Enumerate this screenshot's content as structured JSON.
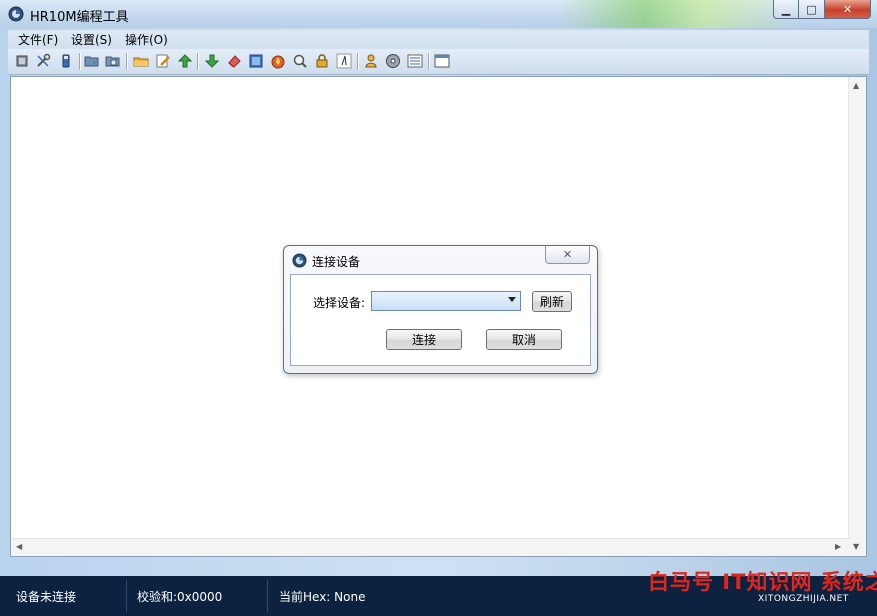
{
  "window": {
    "title": "HR10M编程工具",
    "controls": {
      "minimize": "▁",
      "maximize": "□",
      "close": "✕"
    }
  },
  "menu": {
    "items": [
      "文件(F)",
      "设置(S)",
      "操作(O)"
    ]
  },
  "toolbar": {
    "icons": [
      "chip-icon",
      "tools-icon",
      "usb-icon",
      "folder-open-icon",
      "save-icon",
      "open-file-icon",
      "edit-icon",
      "upload-arrow-icon",
      "download-arrow-icon",
      "eraser-icon",
      "blank-check-icon",
      "fire-icon",
      "search-icon",
      "lock-icon",
      "font-icon",
      "person-icon",
      "disc-icon",
      "list-icon",
      "window-icon"
    ]
  },
  "dialog": {
    "title": "连接设备",
    "close_glyph": "✕",
    "select_label": "选择设备:",
    "device_value": "",
    "refresh_button": "刷新",
    "connect_button": "连接",
    "cancel_button": "取消"
  },
  "status": {
    "connection": "设备未连接",
    "checksum": "校验和:0x0000",
    "current_hex": "当前Hex: None"
  },
  "watermark": {
    "text": "白马号  IT知识网  系统之家",
    "site": "XITONGZHIJIA.NET"
  },
  "colors": {
    "statusbar": "#0d2240",
    "titlebar": "#c3d8ee",
    "close_button": "#c7402a",
    "combo_fill": "#c7def6",
    "watermark": "#e0261b"
  }
}
